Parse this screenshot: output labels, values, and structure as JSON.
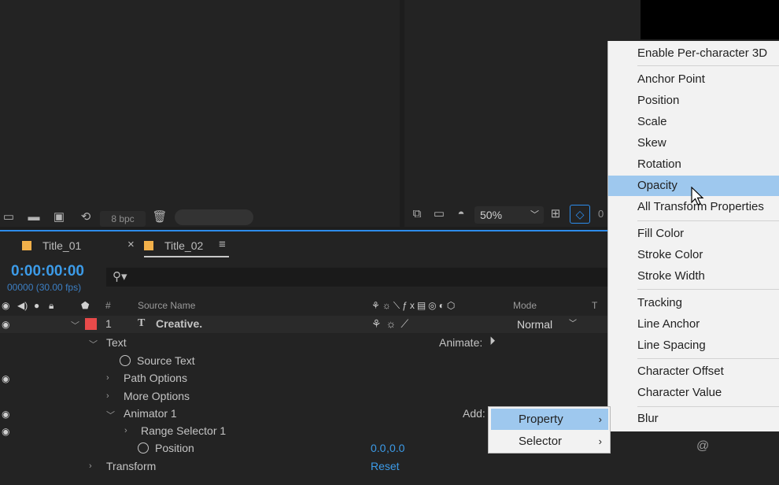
{
  "project_panel": {
    "bpc_label": "8 bpc"
  },
  "viewer": {
    "zoom": "50%",
    "partial_value": "0"
  },
  "timeline": {
    "tabs": [
      {
        "label": "Title_01",
        "color": "#f2b04a",
        "active": false
      },
      {
        "label": "Title_02",
        "color": "#f2b04a",
        "active": true
      }
    ],
    "close_glyph": "×",
    "menu_glyph": "≡",
    "timecode": "0:00:00:00",
    "frames": "00000 (30.00 fps)",
    "columns": {
      "number": "#",
      "source_name": "Source Name",
      "mode": "Mode",
      "track": "T"
    },
    "layer": {
      "number": "1",
      "type_glyph": "T",
      "name": "Creative.",
      "label_color": "#e84a4a",
      "mode": "Normal"
    },
    "rows": {
      "text": "Text",
      "animate_label": "Animate:",
      "source_text": "Source Text",
      "path_options": "Path Options",
      "more_options": "More Options",
      "animator": "Animator 1",
      "add_label": "Add:",
      "range_selector": "Range Selector 1",
      "position": "Position",
      "position_value_x": "0.0",
      "position_value_y": "0.0",
      "transform": "Transform",
      "reset": "Reset"
    }
  },
  "context_menu": {
    "items": [
      "Enable Per-character 3D",
      "Anchor Point",
      "Position",
      "Scale",
      "Skew",
      "Rotation",
      "Opacity",
      "All Transform Properties",
      "Fill Color",
      "Stroke Color",
      "Stroke Width",
      "Tracking",
      "Line Anchor",
      "Line Spacing",
      "Character Offset",
      "Character Value",
      "Blur"
    ],
    "highlighted": "Opacity"
  },
  "sub_menu": {
    "items": [
      "Property",
      "Selector"
    ],
    "highlighted": "Property",
    "arrow": "›"
  },
  "colors": {
    "accent": "#2d8ceb",
    "menu_highlight": "#9ec8ee",
    "timecode": "#3c9be8"
  }
}
